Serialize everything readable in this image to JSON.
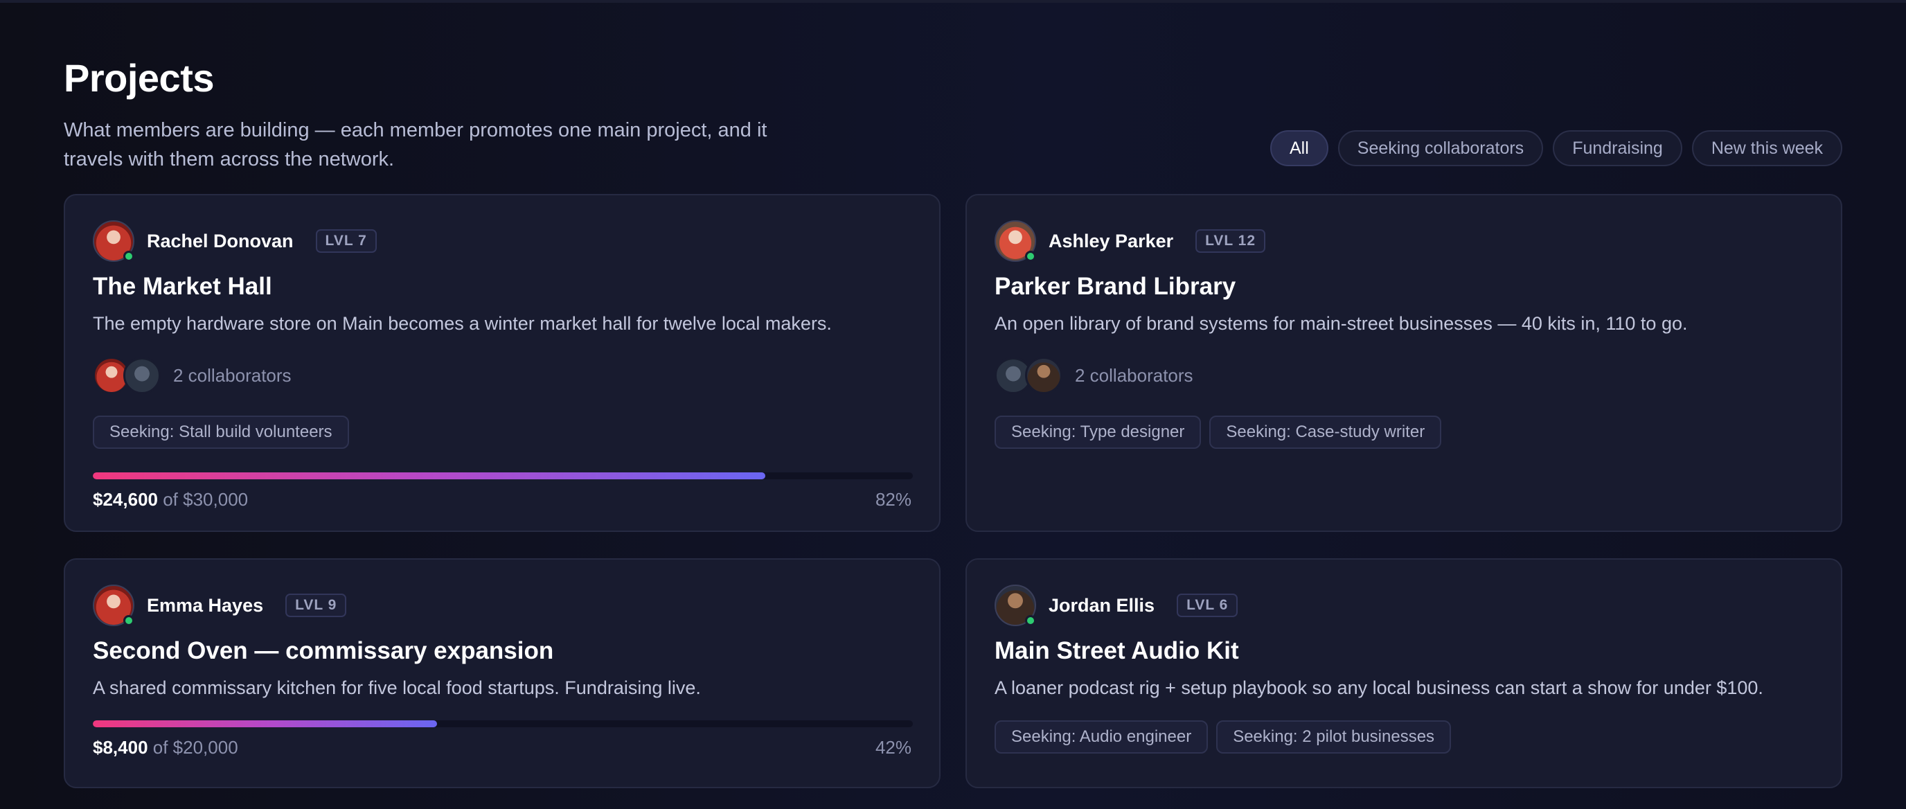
{
  "header": {
    "title": "Projects",
    "subtitle": "What members are building — each member promotes one main project, and it travels with them across the network."
  },
  "filters": [
    "All",
    "Seeking collaborators",
    "Fundraising",
    "New this week"
  ],
  "active_filter": "All",
  "accent_colors": {
    "progress_start": "#f0387e",
    "progress_end": "#6a66f2",
    "online": "#2ecc71"
  },
  "cards": [
    {
      "owner": "Rachel Donovan",
      "level": "LVL 7",
      "title": "The Market Hall",
      "description": "The empty hardware store on Main becomes a winter market hall for twelve local makers.",
      "collaborators": "2 collaborators",
      "seeking": [
        "Seeking: Stall build volunteers"
      ],
      "raised": "$24,600",
      "goal": "of $30,000",
      "percent": "82%",
      "progress": 0.82
    },
    {
      "owner": "Ashley Parker",
      "level": "LVL 12",
      "title": "Parker Brand Library",
      "description": "An open library of brand systems for main-street businesses — 40 kits in, 110 to go.",
      "collaborators": "2 collaborators",
      "seeking": [
        "Seeking: Type designer",
        "Seeking: Case-study writer"
      ]
    },
    {
      "owner": "Emma Hayes",
      "level": "LVL 9",
      "title": "Second Oven — commissary expansion",
      "description": "A shared commissary kitchen for five local food startups. Fundraising live.",
      "raised": "$8,400",
      "goal": "of $20,000",
      "percent": "42%",
      "progress": 0.42
    },
    {
      "owner": "Jordan Ellis",
      "level": "LVL 6",
      "title": "Main Street Audio Kit",
      "description": "A loaner podcast rig + setup playbook so any local business can start a show for under $100.",
      "seeking": [
        "Seeking: Audio engineer",
        "Seeking: 2 pilot businesses"
      ]
    }
  ]
}
